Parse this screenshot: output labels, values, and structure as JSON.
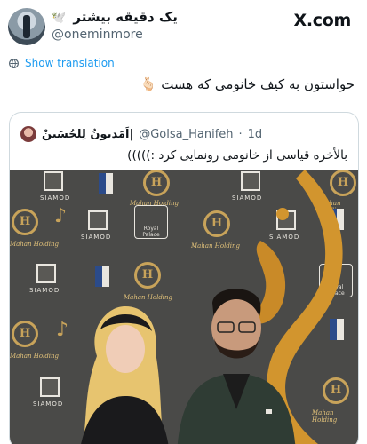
{
  "tweet": {
    "display_name": "یک دقیقه بیشتر",
    "handle": "@oneminmore",
    "brand": "X.com",
    "show_translation": "Show translation",
    "text": "حواستون به کیف خانومی که هست",
    "emoji": "🫰🏻"
  },
  "quoted": {
    "display_name": "اَمَدیونُ لِلحُسَینْ|",
    "handle": "@Golsa_Hanifeh",
    "separator": "·",
    "age": "1d",
    "text": "بالأخره قیاسی از خانومی رونمایی کرد :)))))"
  },
  "backdrop": {
    "siamod": "SIAMOD",
    "mahan": "Mahan Holding",
    "royal": "Royal Palace",
    "h_letter": "H"
  },
  "colors": {
    "link": "#1d9bf0",
    "secondary_text": "#536471",
    "border": "#cfd9de",
    "gold": "#c8a35a"
  }
}
